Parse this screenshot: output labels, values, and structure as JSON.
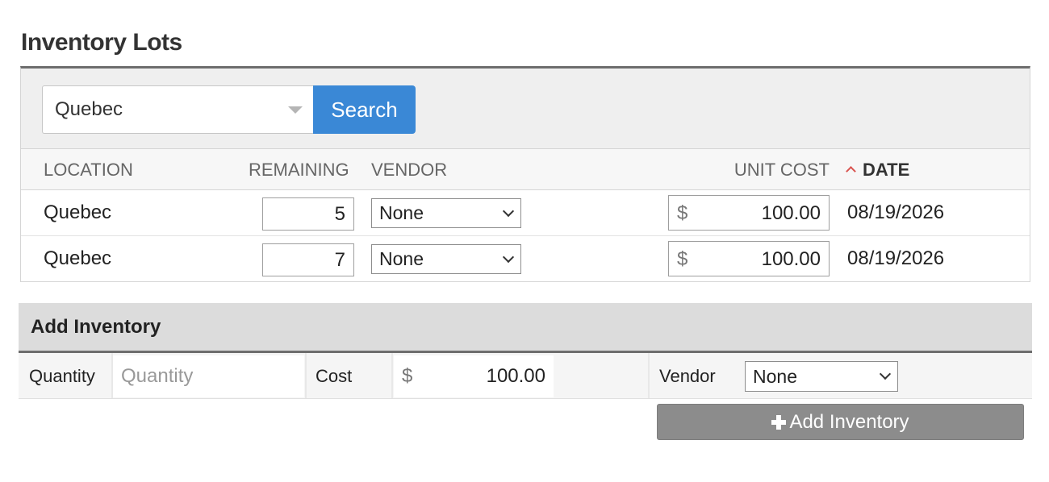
{
  "page": {
    "title": "Inventory Lots"
  },
  "search": {
    "location_value": "Quebec",
    "button_label": "Search"
  },
  "columns": {
    "location": "LOCATION",
    "remaining": "REMAINING",
    "vendor": "VENDOR",
    "unit_cost": "UNIT COST",
    "date": "DATE"
  },
  "lots": [
    {
      "location": "Quebec",
      "remaining": "5",
      "vendor": "None",
      "currency": "$",
      "unit_cost": "100.00",
      "date": "08/19/2026"
    },
    {
      "location": "Quebec",
      "remaining": "7",
      "vendor": "None",
      "currency": "$",
      "unit_cost": "100.00",
      "date": "08/19/2026"
    }
  ],
  "add_inventory": {
    "title": "Add Inventory",
    "quantity_label": "Quantity",
    "quantity_placeholder": "Quantity",
    "cost_label": "Cost",
    "currency": "$",
    "cost_value": "100.00",
    "vendor_label": "Vendor",
    "vendor_value": "None",
    "button_label": "Add Inventory"
  },
  "colors": {
    "accent": "#3a88d6",
    "sort_indicator": "#d9534f",
    "add_button": "#8c8c8c"
  }
}
